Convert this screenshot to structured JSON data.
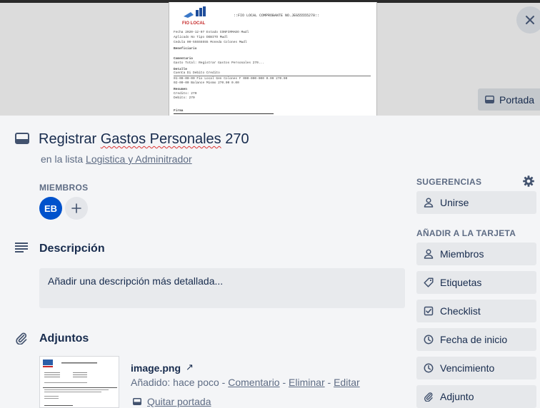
{
  "cover": {
    "button_label": "Portada",
    "doc": {
      "logo_text": "FIO LOCAL",
      "header_line": "::FIO LOCAL COMPROBANTE NO.JEG55555270::",
      "rows": [
        "Fecha         2020-12-07          Estado   CONFIRMADO              Mwdl",
        "Aplicado      No                  Tipo     DEBITO                  Mwdl",
        "Cedula        00-55555555         Moneda   Colones                 Mwdl",
        "Beneficiario",
        "Comentario",
        "Gasto Total: Registrar Gastos Personales 270...",
        "Detalle",
        "Cuenta                             Di                  Debito        Credito",
        "01-00-00-00 Fio Local Gen Colones F 000-000-000               0.00        270.00",
        "02-00-00 Balance Mismo                                     270.00          0.00",
        "Resumen",
        "Credito:    270",
        "Debito:     270",
        "Firma"
      ]
    }
  },
  "card": {
    "title_prefix": "Registrar ",
    "title_wavy": "Gastos Personales",
    "title_suffix": " 270",
    "list_prefix": "en la lista ",
    "list_name": "Logistica y Adminitrador"
  },
  "members": {
    "label": "MIEMBROS",
    "avatar_initials": "EB",
    "add_symbol": "+"
  },
  "description": {
    "title": "Descripción",
    "placeholder": "Añadir una descripción más detallada..."
  },
  "attachments": {
    "title": "Adjuntos",
    "item": {
      "name": "image.png",
      "arrow": "↗",
      "added_prefix": "Añadido: hace poco - ",
      "comment": "Comentario",
      "sep": " - ",
      "delete": "Eliminar",
      "edit": "Editar",
      "remove_cover": "Quitar portada"
    }
  },
  "sidebar": {
    "suggestions_label": "SUGERENCIAS",
    "join_label": "Unirse",
    "add_to_card_label": "AÑADIR A LA TARJETA",
    "buttons": [
      {
        "label": "Miembros",
        "icon": "person-icon"
      },
      {
        "label": "Etiquetas",
        "icon": "tag-icon"
      },
      {
        "label": "Checklist",
        "icon": "checkbox-icon"
      },
      {
        "label": "Fecha de inicio",
        "icon": "clock-icon"
      },
      {
        "label": "Vencimiento",
        "icon": "clock-icon"
      },
      {
        "label": "Adjunto",
        "icon": "paperclip-icon"
      }
    ]
  },
  "colors": {
    "accent": "#0052cc",
    "text": "#172b4d",
    "muted": "#5e6c84",
    "button_bg": "#e6e8eb",
    "page_bg": "#f4f5f7"
  }
}
